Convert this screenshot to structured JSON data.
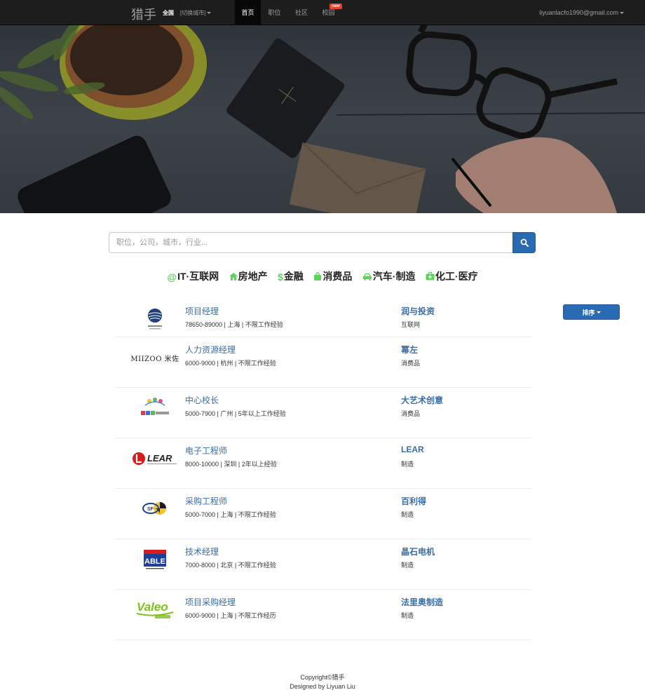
{
  "navbar": {
    "brand": "猎手",
    "city_all": "全国",
    "city_switch": "[切换城市]",
    "items": [
      {
        "label": "首页",
        "active": true
      },
      {
        "label": "职位",
        "active": false
      },
      {
        "label": "社区",
        "active": false
      },
      {
        "label": "校园",
        "active": false
      }
    ],
    "new_badge": "new",
    "user_email": "liyuanlacfo1990@gmail.com"
  },
  "search": {
    "placeholder": "职位，公司，城市，行业...",
    "button_icon": "search-icon"
  },
  "categories": [
    {
      "icon": "@",
      "label": "IT·互联网",
      "icon_name": "at-icon"
    },
    {
      "icon": "⌂",
      "label": "房地产",
      "icon_name": "home-icon"
    },
    {
      "icon": "$",
      "label": "金融",
      "icon_name": "dollar-icon"
    },
    {
      "icon": "▣",
      "label": "消费品",
      "icon_name": "shopping-bag-icon"
    },
    {
      "icon": "🚗",
      "label": "汽车·制造",
      "icon_name": "car-icon"
    },
    {
      "icon": "✚",
      "label": "化工·医疗",
      "icon_name": "medical-kit-icon"
    }
  ],
  "sort_label": "排序",
  "jobs": [
    {
      "title": "项目经理",
      "meta": "78650-89000 | 上海 | 不限工作经验",
      "company": "润与投资",
      "industry": "互联网",
      "logo": "runyu"
    },
    {
      "title": "人力资源经理",
      "meta": "6000-9000 | 杭州 | 不限工作经验",
      "company": "幂左",
      "industry": "消费品",
      "logo": "miizoo",
      "logo_text": "MIIZOO 米佐"
    },
    {
      "title": "中心校长",
      "meta": "5000-7900 | 广州 | 5年以上工作经验",
      "company": "大艺术创意",
      "industry": "消费品",
      "logo": "art"
    },
    {
      "title": "电子工程师",
      "meta": "8000-10000 | 深圳 | 2年以上经验",
      "company": "LEAR",
      "industry": "制造",
      "logo": "lear",
      "logo_text": "LEAR"
    },
    {
      "title": "采购工程师",
      "meta": "5000-7000 | 上海 | 不限工作经验",
      "company": "百利得",
      "industry": "制造",
      "logo": "baili"
    },
    {
      "title": "技术经理",
      "meta": "7000-8000 | 北京 | 不限工作经验",
      "company": "晶石电机",
      "industry": "制造",
      "logo": "able",
      "logo_text": "ABLE"
    },
    {
      "title": "项目采购经理",
      "meta": "6000-9000 | 上海 | 不限工作经历",
      "company": "法里奥制造",
      "industry": "制造",
      "logo": "valeo",
      "logo_text": "Valeo"
    }
  ],
  "footer": {
    "copyright": "Copyright©猎手",
    "designed_by": "Designed by Liyuan Liu"
  },
  "colors": {
    "navbar_bg": "#1d1d1d",
    "accent_blue": "#2a6ab3",
    "link_blue": "#3a6ea8",
    "category_icon_green": "#5cd45c",
    "badge_red": "#e8422b"
  }
}
